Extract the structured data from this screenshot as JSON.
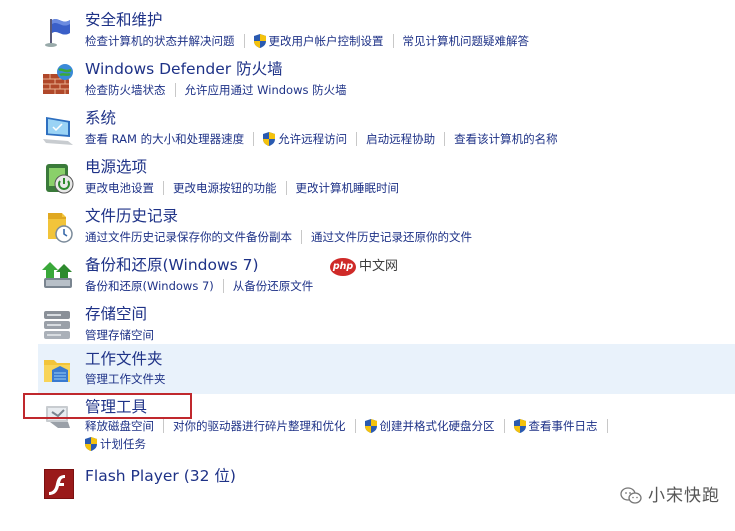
{
  "items": [
    {
      "title": "安全和维护",
      "icon": "flag-icon",
      "links": [
        "检查计算机的状态并解决问题",
        "更改用户帐户控制设置",
        "常见计算机问题疑难解答"
      ]
    },
    {
      "title": "Windows Defender 防火墙",
      "icon": "firewall-icon",
      "links": [
        "检查防火墙状态",
        "允许应用通过 Windows 防火墙"
      ]
    },
    {
      "title": "系统",
      "icon": "computer-icon",
      "links": [
        "查看 RAM 的大小和处理器速度",
        "允许远程访问",
        "启动远程协助",
        "查看该计算机的名称"
      ]
    },
    {
      "title": "电源选项",
      "icon": "power-icon",
      "links": [
        "更改电池设置",
        "更改电源按钮的功能",
        "更改计算机睡眠时间"
      ]
    },
    {
      "title": "文件历史记录",
      "icon": "file-history-icon",
      "links": [
        "通过文件历史记录保存你的文件备份副本",
        "通过文件历史记录还原你的文件"
      ]
    },
    {
      "title": "备份和还原(Windows 7)",
      "icon": "backup-icon",
      "links": [
        "备份和还原(Windows 7)",
        "从备份还原文件"
      ]
    },
    {
      "title": "存储空间",
      "icon": "storage-icon",
      "links": [
        "管理存储空间"
      ]
    },
    {
      "title": "工作文件夹",
      "icon": "work-folders-icon",
      "links": [
        "管理工作文件夹"
      ]
    },
    {
      "title": "管理工具",
      "icon": "admin-tools-icon",
      "links": [
        "释放磁盘空间",
        "对你的驱动器进行碎片整理和优化",
        "创建并格式化硬盘分区",
        "查看事件日志",
        "计划任务"
      ]
    },
    {
      "title": "Flash Player (32 位)",
      "icon": "flash-icon",
      "links": []
    }
  ],
  "watermark": {
    "logo_text": "php",
    "site_text": "中文网"
  },
  "brand": {
    "text": "小宋快跑",
    "icon": "wechat-icon"
  },
  "colors": {
    "link": "#1e3287",
    "hover_row": "#e9f2fb",
    "highlight_border": "#c0282d"
  }
}
